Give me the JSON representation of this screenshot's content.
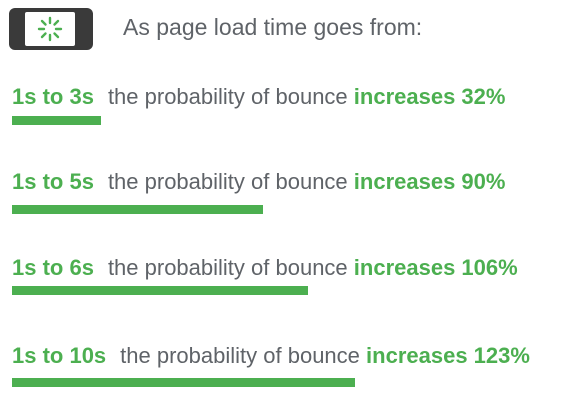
{
  "header": {
    "text": "As page load time goes from:",
    "icon": "phone-loading-icon"
  },
  "colors": {
    "accent": "#4caf50",
    "text": "#5f6368",
    "phone": "#3a3a3a"
  },
  "chart_data": {
    "type": "bar",
    "orientation": "horizontal",
    "categories": [
      "1s to 3s",
      "1s to 5s",
      "1s to 6s",
      "1s to 10s"
    ],
    "values": [
      32,
      90,
      106,
      123
    ],
    "unit": "%",
    "rows": [
      {
        "range": "1s to 3s",
        "desc": "the probability of bounce",
        "inc": "increases 32%"
      },
      {
        "range": "1s to 5s",
        "desc": "the probability of bounce",
        "inc": "increases 90%"
      },
      {
        "range": "1s to 6s",
        "desc": "the probability of bounce",
        "inc": "increases 106%"
      },
      {
        "range": "1s to 10s",
        "desc": "the probability of bounce",
        "inc": "increases 123%"
      }
    ],
    "grid": false
  }
}
